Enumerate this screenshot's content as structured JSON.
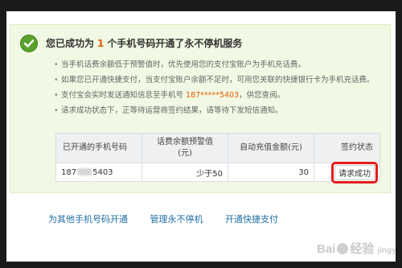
{
  "success": {
    "title_prefix": "您已成功为",
    "count": "1",
    "title_suffix": "个手机号码开通了永不停机服务",
    "bullets": [
      "当手机话费余额低于预警值时，优先使用您的支付宝账户为手机充话费。",
      "如果您已开通快捷支付，当支付宝账户余额不足时，可用您关联的快捷银行卡为手机充话费。",
      "支付宝会实时发送通知信息至手机号",
      "请求成功状态下，正等待运营商签约结果，请等待下发短信通知。"
    ],
    "notify_phone": "187*****5403",
    "notify_suffix": "，供您查阅。"
  },
  "table": {
    "headers": {
      "phone": "已开通的手机号码",
      "warn_line1": "话费余额预警值",
      "warn_line2": "(元)",
      "auto": "自动充值金额(元)",
      "status": "签约状态"
    },
    "row": {
      "phone_prefix": "187",
      "phone_suffix": "5403",
      "warn": "少于50",
      "auto": "30",
      "status": "请求成功"
    }
  },
  "links": {
    "other": "为其他手机号码开通",
    "manage": "管理永不停机",
    "quickpay": "开通快捷支付"
  },
  "watermark": {
    "left": "Bai",
    "right": "经验",
    "sub": "jingyan.baidu.com"
  },
  "colors": {
    "accent_orange": "#e65c00",
    "success_bg": "#f1f8e3",
    "link_blue": "#1f6ea3",
    "highlight_red": "#e31b1b"
  }
}
